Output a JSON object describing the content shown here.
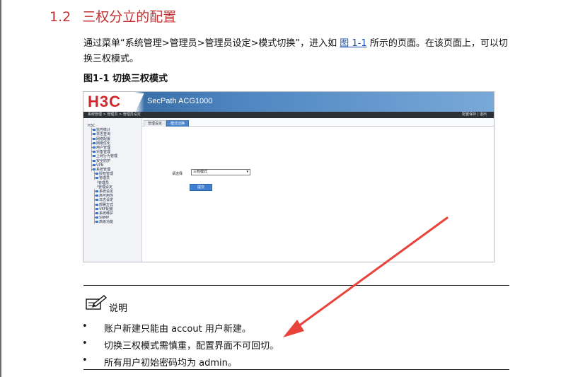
{
  "section": {
    "number": "1.2",
    "title": "三权分立的配置"
  },
  "paragraph": {
    "text_before_link": "通过菜单“系统管理>管理员>管理员设定>模式切换”，进入如",
    "link": "图 1-1",
    "text_after_link": "所示的页面。在该页面上，可以切换三权模式。"
  },
  "figure": {
    "caption": "图1-1  切换三权模式",
    "screenshot": {
      "logo": "H3C",
      "product": "SecPath ACG1000",
      "breadcrumb": "系统管理 > 管理员 > 管理员设定",
      "top_links": "配置保存  |  退出",
      "tree": [
        {
          "label": "H3C",
          "level": 0
        },
        {
          "label": "监控统计",
          "level": 1
        },
        {
          "label": "日志查询",
          "level": 1
        },
        {
          "label": "网络配置",
          "level": 1
        },
        {
          "label": "网络优化",
          "level": 1
        },
        {
          "label": "用户管理",
          "level": 1
        },
        {
          "label": "对象管理",
          "level": 1
        },
        {
          "label": "上网行为管理",
          "level": 1
        },
        {
          "label": "安全防护",
          "level": 1
        },
        {
          "label": "VPN",
          "level": 1
        },
        {
          "label": "系统管理",
          "level": 1
        },
        {
          "label": "授权管理",
          "level": 2
        },
        {
          "label": "管理员",
          "level": 2
        },
        {
          "label": "管理员",
          "level": 3
        },
        {
          "label": "管理设定",
          "level": 3
        },
        {
          "label": "系统设定",
          "level": 2
        },
        {
          "label": "高可用性",
          "level": 2
        },
        {
          "label": "日志设定",
          "level": 2
        },
        {
          "label": "部署方式",
          "level": 2
        },
        {
          "label": "VRF配置",
          "level": 2
        },
        {
          "label": "系统维护",
          "level": 2
        },
        {
          "label": "SNMP",
          "level": 2
        },
        {
          "label": "高级功能",
          "level": 2
        }
      ],
      "tabs": [
        "管理设定",
        "模式切换"
      ],
      "active_tab": 1,
      "form_label": "请选择",
      "select_value": "三权模式",
      "submit_label": "提交"
    }
  },
  "note": {
    "label": "说明",
    "items": [
      "账户新建只能由 accout 用户新建。",
      "切换三权模式需慎重，配置界面不可回切。",
      "所有用户初始密码均为 admin。"
    ]
  },
  "colors": {
    "heading": "#c0302f",
    "link": "#1d4fae",
    "annotation_arrow": "#e8423a",
    "brand": "#d1262b"
  }
}
